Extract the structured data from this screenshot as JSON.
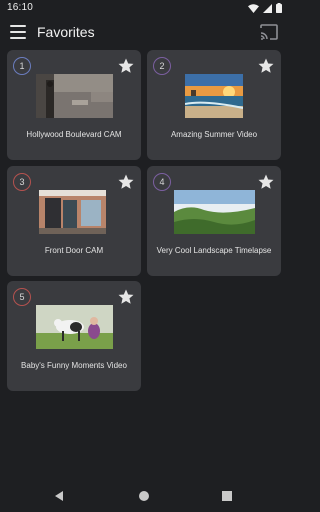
{
  "status": {
    "time": "16:10"
  },
  "appbar": {
    "title": "Favorites"
  },
  "favorites": [
    {
      "number": "1",
      "label": "Hollywood Boulevard CAM",
      "badge_color": "#6b7dbf"
    },
    {
      "number": "2",
      "label": "Amazing Summer Video",
      "badge_color": "#7b5fa0"
    },
    {
      "number": "3",
      "label": "Front Door CAM",
      "badge_color": "#b4524f"
    },
    {
      "number": "4",
      "label": "Very Cool Landscape Timelapse",
      "badge_color": "#7b5fa0"
    },
    {
      "number": "5",
      "label": "Baby's Funny Moments Video",
      "badge_color": "#b4524f"
    }
  ],
  "colors": {
    "background": "#1e1f22",
    "card": "#3a3b3f",
    "star": "#e6e6e6"
  },
  "icons": {
    "status": [
      "wifi-icon",
      "signal-icon",
      "battery-icon"
    ],
    "appbar": [
      "menu-icon",
      "cast-icon"
    ],
    "card": [
      "star-icon"
    ],
    "navbar": [
      "back-icon",
      "home-icon",
      "recents-icon"
    ]
  }
}
